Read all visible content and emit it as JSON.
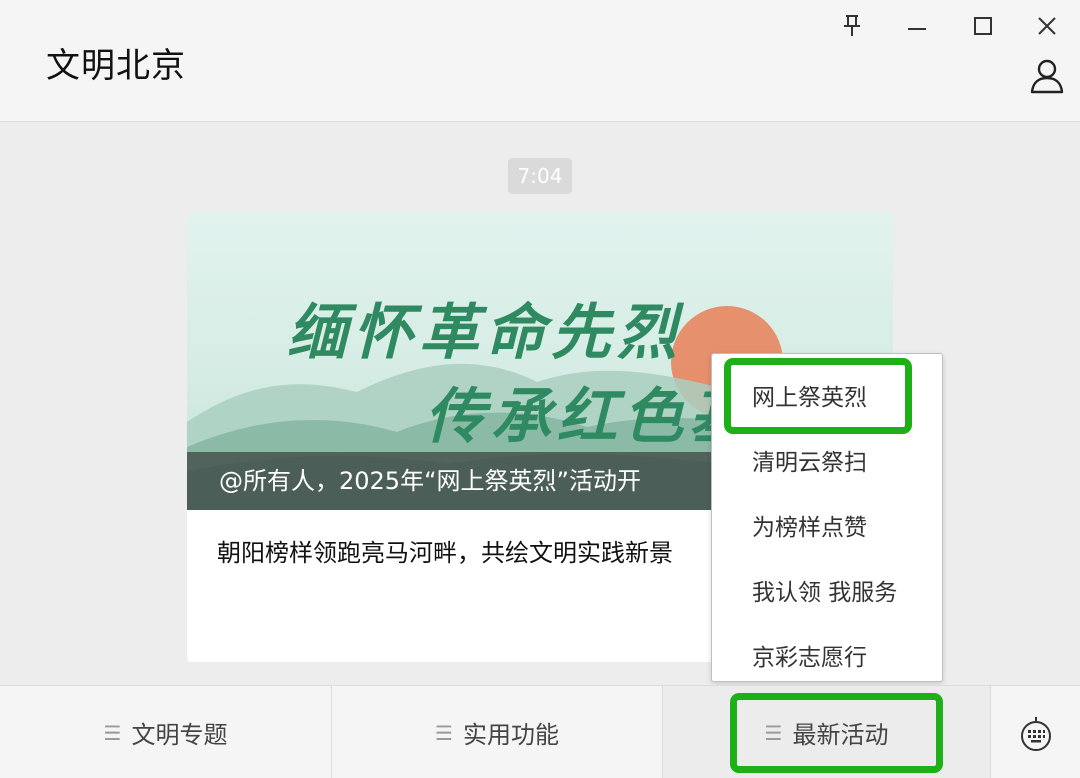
{
  "header": {
    "title": "文明北京"
  },
  "colors": {
    "highlight": "#1fb019",
    "cover_text": "#2f8a62",
    "sun": "#e8855f"
  },
  "icons": {
    "pin": "pin-icon",
    "minimize": "minimize-icon",
    "maximize": "maximize-icon",
    "close": "close-icon",
    "profile": "profile-icon",
    "keyboard": "keyboard-icon",
    "menu": "hamburger-icon"
  },
  "chat": {
    "timestamp": "7:04",
    "card": {
      "cover_line1": "缅怀革命先烈",
      "cover_line2": "传承红色基",
      "cover_caption": "@所有人，2025年“网上祭英烈”活动开",
      "body_text": "朝阳榜样领跑亮马河畔，共绘文明实践新景"
    }
  },
  "submenu": {
    "items": [
      {
        "label": "网上祭英烈",
        "highlighted": true
      },
      {
        "label": "清明云祭扫"
      },
      {
        "label": "为榜样点赞"
      },
      {
        "label": "我认领 我服务"
      },
      {
        "label": "京彩志愿行"
      }
    ]
  },
  "footer": {
    "menus": [
      {
        "label": "文明专题"
      },
      {
        "label": "实用功能"
      },
      {
        "label": "最新活动",
        "active": true,
        "highlighted": true
      }
    ]
  }
}
